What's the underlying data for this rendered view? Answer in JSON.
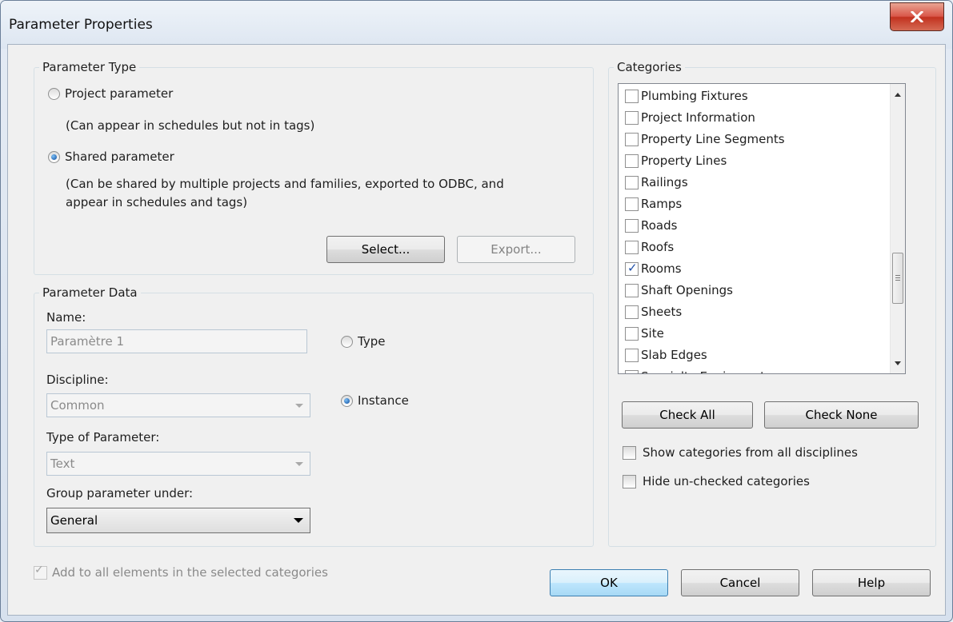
{
  "window": {
    "title": "Parameter Properties",
    "close_glyph": "X"
  },
  "parameter_type": {
    "legend": "Parameter Type",
    "project_label": "Project parameter",
    "project_note": "(Can appear in schedules but not in tags)",
    "shared_label": "Shared parameter",
    "shared_note_line1": "(Can be shared by multiple projects and families, exported to ODBC, and",
    "shared_note_line2": "appear in schedules and tags)",
    "selected": "shared",
    "select_button": "Select...",
    "export_button": "Export..."
  },
  "parameter_data": {
    "legend": "Parameter Data",
    "name_label": "Name:",
    "name_value": "Paramètre 1",
    "discipline_label": "Discipline:",
    "discipline_value": "Common",
    "type_of_parameter_label": "Type of Parameter:",
    "type_of_parameter_value": "Text",
    "group_label": "Group parameter under:",
    "group_value": "General",
    "type_radio_label": "Type",
    "instance_radio_label": "Instance",
    "selected_binding": "instance"
  },
  "categories": {
    "legend": "Categories",
    "items": [
      {
        "label": "Plumbing Fixtures",
        "checked": false
      },
      {
        "label": "Project Information",
        "checked": false
      },
      {
        "label": "Property Line Segments",
        "checked": false
      },
      {
        "label": "Property Lines",
        "checked": false
      },
      {
        "label": "Railings",
        "checked": false
      },
      {
        "label": "Ramps",
        "checked": false
      },
      {
        "label": "Roads",
        "checked": false
      },
      {
        "label": "Roofs",
        "checked": false
      },
      {
        "label": "Rooms",
        "checked": true
      },
      {
        "label": "Shaft Openings",
        "checked": false
      },
      {
        "label": "Sheets",
        "checked": false
      },
      {
        "label": "Site",
        "checked": false
      },
      {
        "label": "Slab Edges",
        "checked": false
      },
      {
        "label": "Specialty Equipment",
        "checked": false
      }
    ],
    "check_all": "Check All",
    "check_none": "Check None",
    "show_all_disciplines": "Show categories from all disciplines",
    "hide_unchecked": "Hide un-checked categories"
  },
  "footer": {
    "add_to_all": "Add to all elements in the selected categories",
    "ok": "OK",
    "cancel": "Cancel",
    "help": "Help"
  }
}
